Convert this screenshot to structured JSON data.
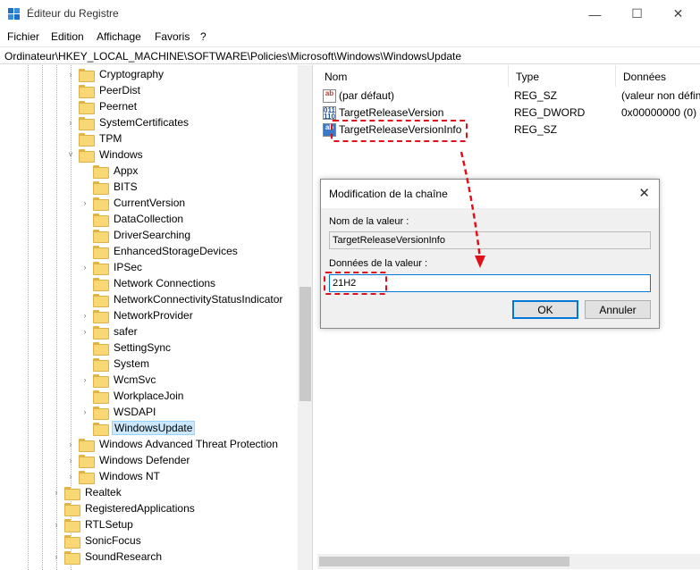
{
  "window": {
    "title": "Éditeur du Registre",
    "minimize_glyph": "—",
    "maximize_glyph": "☐",
    "close_glyph": "✕"
  },
  "menu": [
    "Fichier",
    "Edition",
    "Affichage",
    "Favoris",
    "?"
  ],
  "address": "Ordinateur\\HKEY_LOCAL_MACHINE\\SOFTWARE\\Policies\\Microsoft\\Windows\\WindowsUpdate",
  "tree": [
    {
      "label": "Cryptography",
      "expander": "›"
    },
    {
      "label": "PeerDist",
      "expander": ""
    },
    {
      "label": "Peernet",
      "expander": ""
    },
    {
      "label": "SystemCertificates",
      "expander": "›"
    },
    {
      "label": "TPM",
      "expander": ""
    },
    {
      "label": "Windows",
      "expander": "˅"
    },
    {
      "label": "Appx",
      "expander": ""
    },
    {
      "label": "BITS",
      "expander": ""
    },
    {
      "label": "CurrentVersion",
      "expander": "›"
    },
    {
      "label": "DataCollection",
      "expander": ""
    },
    {
      "label": "DriverSearching",
      "expander": ""
    },
    {
      "label": "EnhancedStorageDevices",
      "expander": ""
    },
    {
      "label": "IPSec",
      "expander": "›"
    },
    {
      "label": "Network Connections",
      "expander": ""
    },
    {
      "label": "NetworkConnectivityStatusIndicator",
      "expander": ""
    },
    {
      "label": "NetworkProvider",
      "expander": "›"
    },
    {
      "label": "safer",
      "expander": "›"
    },
    {
      "label": "SettingSync",
      "expander": ""
    },
    {
      "label": "System",
      "expander": ""
    },
    {
      "label": "WcmSvc",
      "expander": "›"
    },
    {
      "label": "WorkplaceJoin",
      "expander": ""
    },
    {
      "label": "WSDAPI",
      "expander": "›"
    },
    {
      "label": "WindowsUpdate",
      "expander": "",
      "selected": true
    },
    {
      "label": "Windows Advanced Threat Protection",
      "expander": "›"
    },
    {
      "label": "Windows Defender",
      "expander": "›"
    },
    {
      "label": "Windows NT",
      "expander": "›"
    },
    {
      "label": "Realtek",
      "expander": "›"
    },
    {
      "label": "RegisteredApplications",
      "expander": ""
    },
    {
      "label": "RTLSetup",
      "expander": "›"
    },
    {
      "label": "SonicFocus",
      "expander": ""
    },
    {
      "label": "SoundResearch",
      "expander": "›"
    }
  ],
  "list": {
    "columns": [
      "Nom",
      "Type",
      "Données"
    ],
    "rows": [
      {
        "name": "(par défaut)",
        "type": "REG_SZ",
        "data": "(valeur non défini",
        "icon": "ab"
      },
      {
        "name": "TargetReleaseVersion",
        "type": "REG_DWORD",
        "data": "0x00000000 (0)",
        "icon": "011\n110"
      },
      {
        "name": "TargetReleaseVersionInfo",
        "type": "REG_SZ",
        "data": "",
        "icon": "ab"
      }
    ]
  },
  "dialog": {
    "title": "Modification de la chaîne",
    "close_glyph": "✕",
    "name_label": "Nom de la valeur :",
    "name_value": "TargetReleaseVersionInfo",
    "data_label": "Données de la valeur :",
    "data_value": "21H2",
    "ok_label": "OK",
    "cancel_label": "Annuler"
  },
  "colors": {
    "annotation": "#e0101a",
    "selection_bg": "#cce8ff",
    "accent": "#0078d7"
  }
}
